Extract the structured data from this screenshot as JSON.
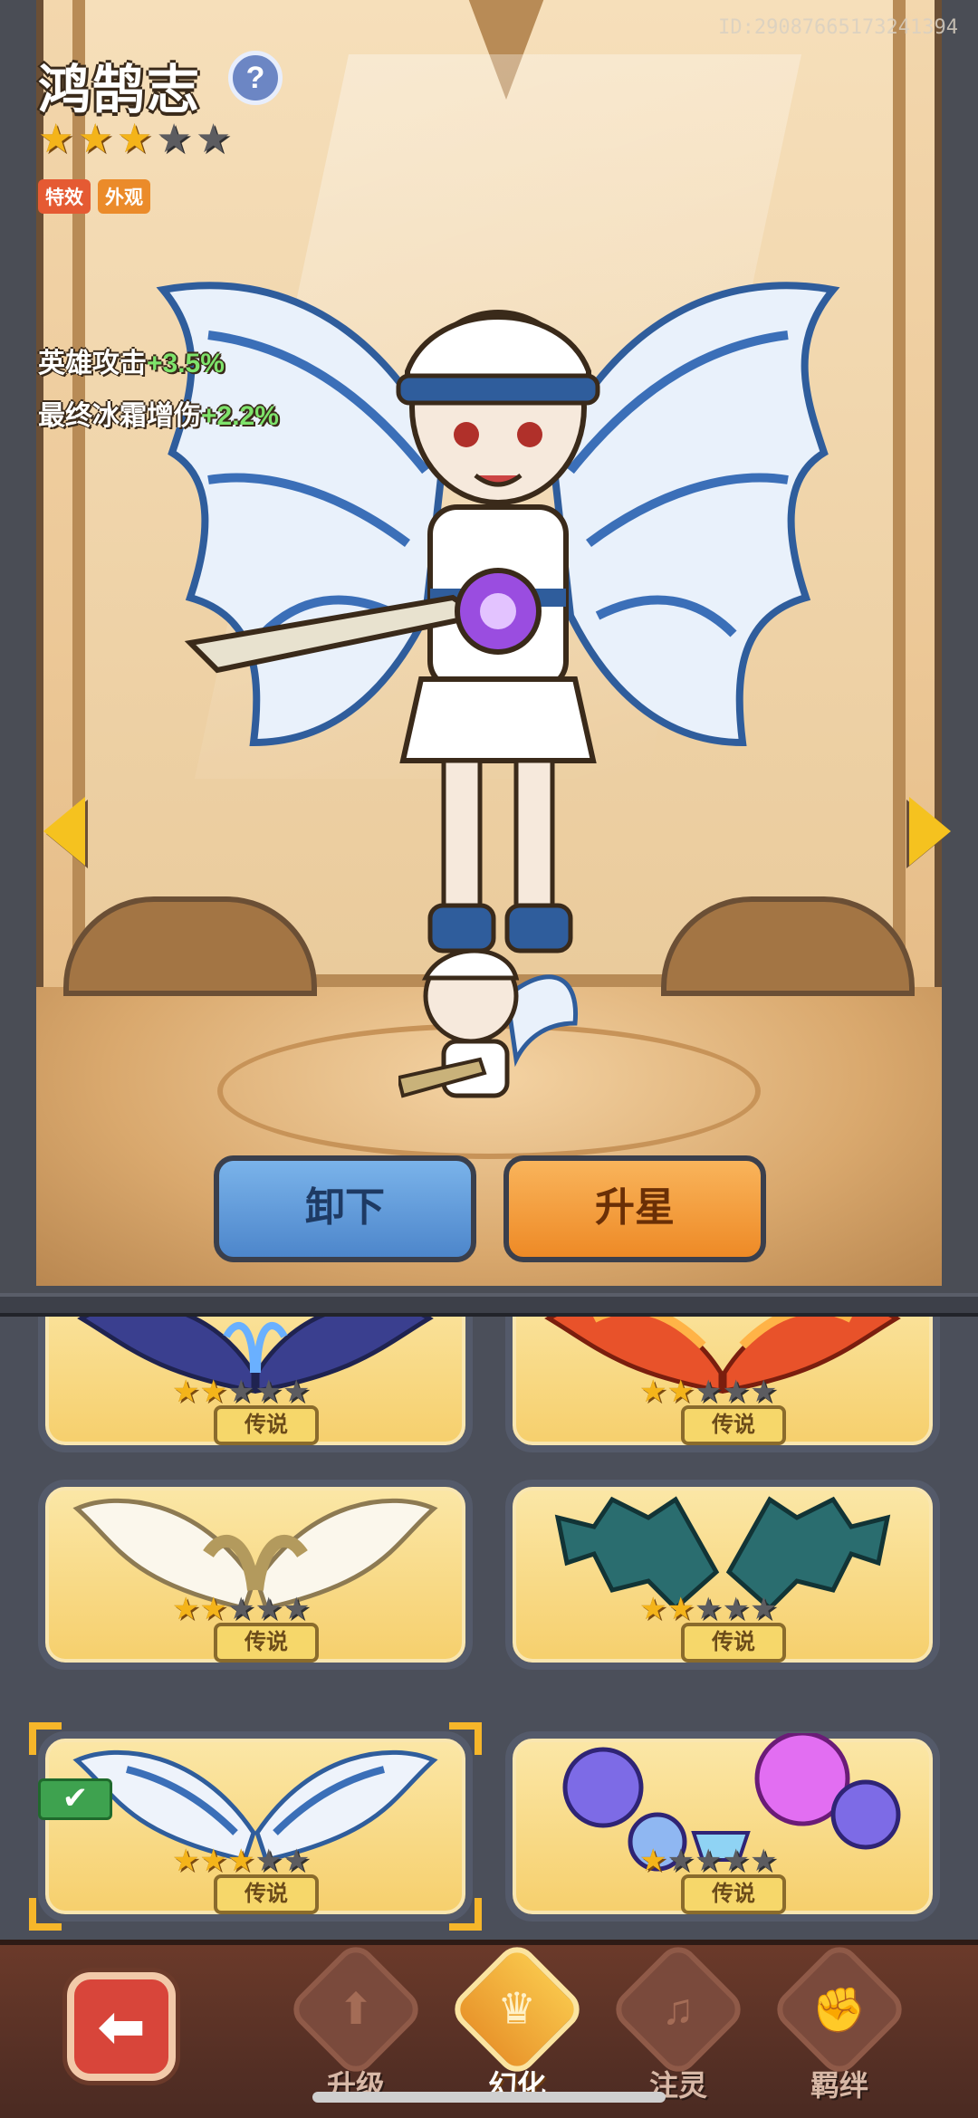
{
  "hero": {
    "name": "鸿鹄志",
    "help_icon": "question-mark",
    "stars_total": 5,
    "stars_filled": 3,
    "tags": [
      "特效",
      "外观"
    ],
    "stats": [
      {
        "label": "英雄攻击",
        "value": "+3.5%"
      },
      {
        "label": "最终冰霜增伤",
        "value": "+2.2%"
      }
    ],
    "id_text": "ID:29087665173241394"
  },
  "actions": {
    "unequip_label": "卸下",
    "star_up_label": "升星"
  },
  "cards": [
    {
      "rarity": "传说",
      "stars_filled": 2,
      "stars_total": 5,
      "theme": "dark-blue-wings",
      "selected": false
    },
    {
      "rarity": "传说",
      "stars_filled": 2,
      "stars_total": 5,
      "theme": "fire-wings",
      "selected": false
    },
    {
      "rarity": "传说",
      "stars_filled": 2,
      "stars_total": 5,
      "theme": "golden-white-wings",
      "selected": false
    },
    {
      "rarity": "传说",
      "stars_filled": 2,
      "stars_total": 5,
      "theme": "bat-wings",
      "selected": false
    },
    {
      "rarity": "传说",
      "stars_filled": 3,
      "stars_total": 5,
      "theme": "ice-feather-wings",
      "selected": true
    },
    {
      "rarity": "传说",
      "stars_filled": 1,
      "stars_total": 5,
      "theme": "balloon-wings",
      "selected": false
    }
  ],
  "bottom_nav": {
    "back_icon": "back-arrow",
    "items": [
      {
        "label": "升级",
        "icon": "arrow-up"
      },
      {
        "label": "幻化",
        "icon": "fox-emblem",
        "active": true
      },
      {
        "label": "注灵",
        "icon": "harp"
      },
      {
        "label": "羁绊",
        "icon": "fist"
      }
    ]
  },
  "colors": {
    "star_on": "#f4b41a",
    "star_off": "#5c5c60",
    "stat_value": "#7ee36b",
    "unequip_btn": "#5d96d6",
    "star_up_btn": "#f29a36"
  }
}
